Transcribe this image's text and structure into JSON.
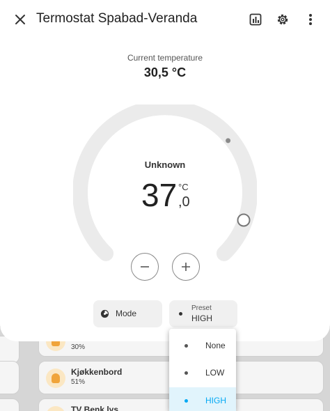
{
  "dialog": {
    "title": "Termostat Spabad-Veranda",
    "current_label": "Current temperature",
    "current_value": "30,5 °C",
    "state": "Unknown",
    "target_integer": "37",
    "target_unit": "°C",
    "target_decimal": ",0"
  },
  "controls": {
    "mode_label": "Mode",
    "preset_label": "Preset",
    "preset_value": "HIGH"
  },
  "preset_menu": {
    "options": [
      "None",
      "LOW",
      "HIGH"
    ],
    "selected": "HIGH"
  },
  "background_cards": [
    {
      "name": "",
      "value": "30%"
    },
    {
      "name": "Kjøkkenbord",
      "value": "51%"
    },
    {
      "name": "TV Benk lys",
      "value": ""
    }
  ],
  "colors": {
    "accent": "#03a9f4",
    "dial_track": "#ebebeb",
    "bulb": "#f0a43a"
  },
  "icons": {
    "close": "close-icon",
    "history": "chart-icon",
    "settings": "gear-icon",
    "more": "more-vertical-icon"
  }
}
